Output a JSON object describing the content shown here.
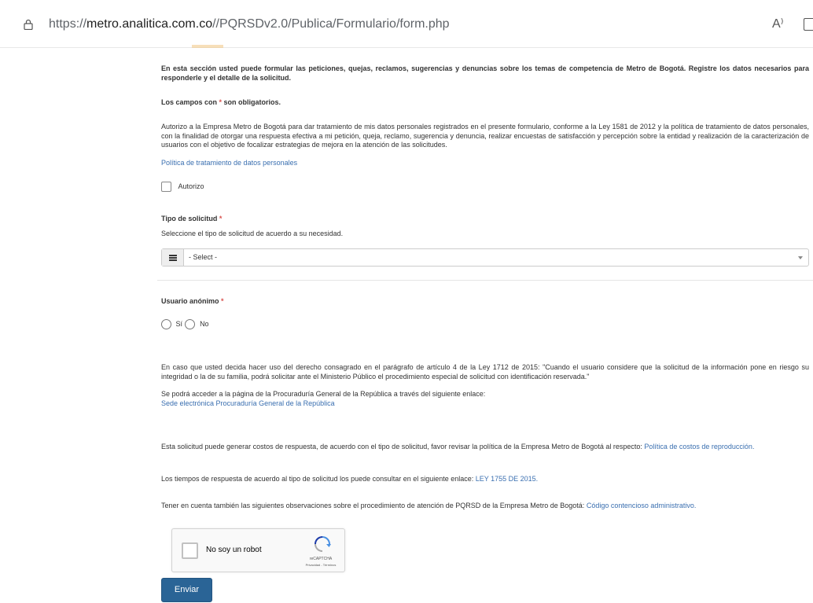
{
  "browser": {
    "url_prefix": "https://",
    "url_host": "metro.analitica.com.co",
    "url_path": "//PQRSDv2.0/Publica/Formulario/form.php",
    "read_aloud": "A⁾"
  },
  "form": {
    "intro": "En esta sección usted puede formular las peticiones, quejas, reclamos, sugerencias y denuncias sobre los temas de competencia de Metro de Bogotá. Registre los datos necesarios para responderle y el detalle de la solicitud.",
    "required_note_prefix": "Los campos con ",
    "required_star": "*",
    "required_note_suffix": " son obligatorios.",
    "consent_text": "Autorizo a la Empresa Metro de Bogotá para dar tratamiento de mis datos personales registrados en el presente formulario, conforme a la Ley 1581 de 2012 y la política de tratamiento de datos personales, con la finalidad de otorgar una respuesta efectiva a mi petición, queja, reclamo, sugerencia y denuncia, realizar encuestas de satisfacción y percepción sobre la entidad y realización de la caracterización de usuarios con el objetivo de focalizar estrategias de mejora en la atención de las solicitudes.",
    "policy_link": "Política de tratamiento de datos personales",
    "authorize_label": "Autorizo",
    "request_type_label": "Tipo de solicitud",
    "request_type_help": "Seleccione el tipo de solicitud de acuerdo a su necesidad.",
    "request_type_value": "- Select -",
    "anonymous_label": "Usuario anónimo",
    "option_yes": "Sí",
    "option_no": "No",
    "anon_info_1": "En caso que usted decida hacer uso del derecho consagrado en el parágrafo de artículo 4 de la Ley 1712 de 2015: \"Cuando el usuario considere que la solicitud de la información pone en riesgo su integridad o la de su familia, podrá solicitar ante el Ministerio Público el procedimiento especial de solicitud con identificación reservada.\"",
    "anon_info_2": "Se podrá acceder a la página de la Procuraduría General de la República a través del siguiente enlace:",
    "procuraduria_link": "Sede electrónica Procuraduría General de la República",
    "costs_text": "Esta solicitud puede generar costos de respuesta, de acuerdo con el tipo de solicitud, favor revisar la política de la Empresa Metro de Bogotá al respecto: ",
    "costs_link": "Política de costos de reproducción.",
    "times_text": "Los tiempos de respuesta de acuerdo al tipo de solicitud los puede consultar en el siguiente enlace: ",
    "times_link": "LEY 1755 DE 2015.",
    "observations_text": "Tener en cuenta también las siguientes observaciones sobre el procedimiento de atención de PQRSD de la Empresa Metro de Bogotá: ",
    "observations_link": "Código contencioso administrativo.",
    "submit_label": "Enviar"
  },
  "captcha": {
    "label": "No soy un robot",
    "brand": "reCAPTCHA",
    "terms": "Privacidad - Términos"
  }
}
